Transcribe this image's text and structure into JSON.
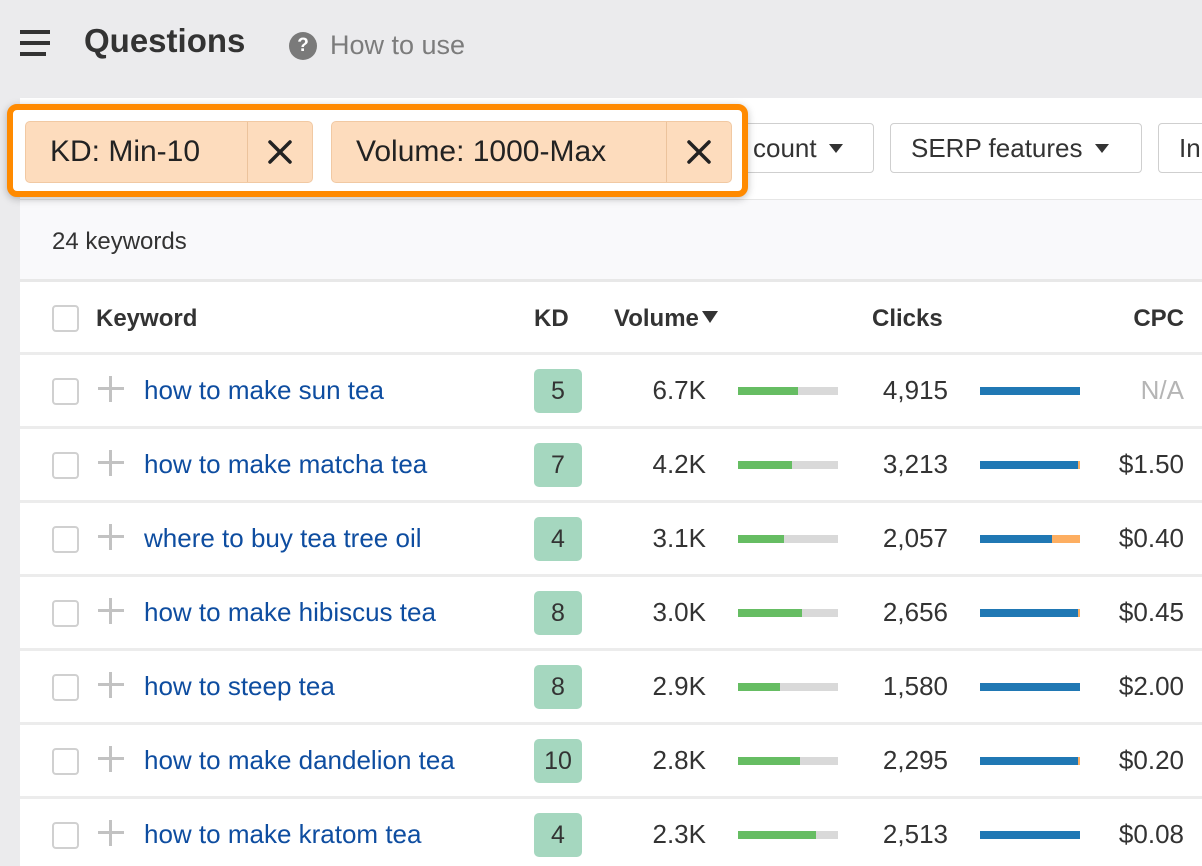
{
  "header": {
    "title": "Questions",
    "help_icon": "question-circle-icon",
    "help_glyph": "?",
    "help_label": "How to use",
    "menu_icon": "hamburger-menu-icon"
  },
  "filters": {
    "active": [
      {
        "label": "KD: Min-10",
        "close_icon": "close-x-icon"
      },
      {
        "label": "Volume: 1000-Max",
        "close_icon": "close-x-icon"
      }
    ],
    "buttons": [
      {
        "label": "count",
        "icon": "caret-down-icon"
      },
      {
        "label": "SERP features",
        "icon": "caret-down-icon"
      },
      {
        "label": "In",
        "icon": ""
      }
    ],
    "highlight_color": "#ff8a00"
  },
  "results": {
    "count_label": "24 keywords"
  },
  "table": {
    "columns": {
      "keyword": "Keyword",
      "kd": "KD",
      "volume": "Volume",
      "clicks": "Clicks",
      "cpc": "CPC"
    },
    "sort": {
      "column": "volume",
      "direction": "desc"
    },
    "rows": [
      {
        "keyword": "how to make sun tea",
        "kd": "5",
        "volume": "6.7K",
        "volume_bar": 0.6,
        "clicks": "4,915",
        "clicks_paid_share": 0.0,
        "cpc": "N/A"
      },
      {
        "keyword": "how to make matcha tea",
        "kd": "7",
        "volume": "4.2K",
        "volume_bar": 0.54,
        "clicks": "3,213",
        "clicks_paid_share": 0.02,
        "cpc": "$1.50"
      },
      {
        "keyword": "where to buy tea tree oil",
        "kd": "4",
        "volume": "3.1K",
        "volume_bar": 0.46,
        "clicks": "2,057",
        "clicks_paid_share": 0.28,
        "cpc": "$0.40"
      },
      {
        "keyword": "how to make hibiscus tea",
        "kd": "8",
        "volume": "3.0K",
        "volume_bar": 0.64,
        "clicks": "2,656",
        "clicks_paid_share": 0.02,
        "cpc": "$0.45"
      },
      {
        "keyword": "how to steep tea",
        "kd": "8",
        "volume": "2.9K",
        "volume_bar": 0.42,
        "clicks": "1,580",
        "clicks_paid_share": 0.0,
        "cpc": "$2.00"
      },
      {
        "keyword": "how to make dandelion tea",
        "kd": "10",
        "volume": "2.8K",
        "volume_bar": 0.62,
        "clicks": "2,295",
        "clicks_paid_share": 0.02,
        "cpc": "$0.20"
      },
      {
        "keyword": "how to make kratom tea",
        "kd": "4",
        "volume": "2.3K",
        "volume_bar": 0.78,
        "clicks": "2,513",
        "clicks_paid_share": 0.0,
        "cpc": "$0.08"
      }
    ]
  },
  "colors": {
    "link": "#0e4da0",
    "kd_badge": "#a5d7bf",
    "volume_bar": "#66bd63",
    "organic_clicks": "#2078b4",
    "paid_clicks": "#fdae61",
    "chip_bg": "#fddcbd"
  }
}
